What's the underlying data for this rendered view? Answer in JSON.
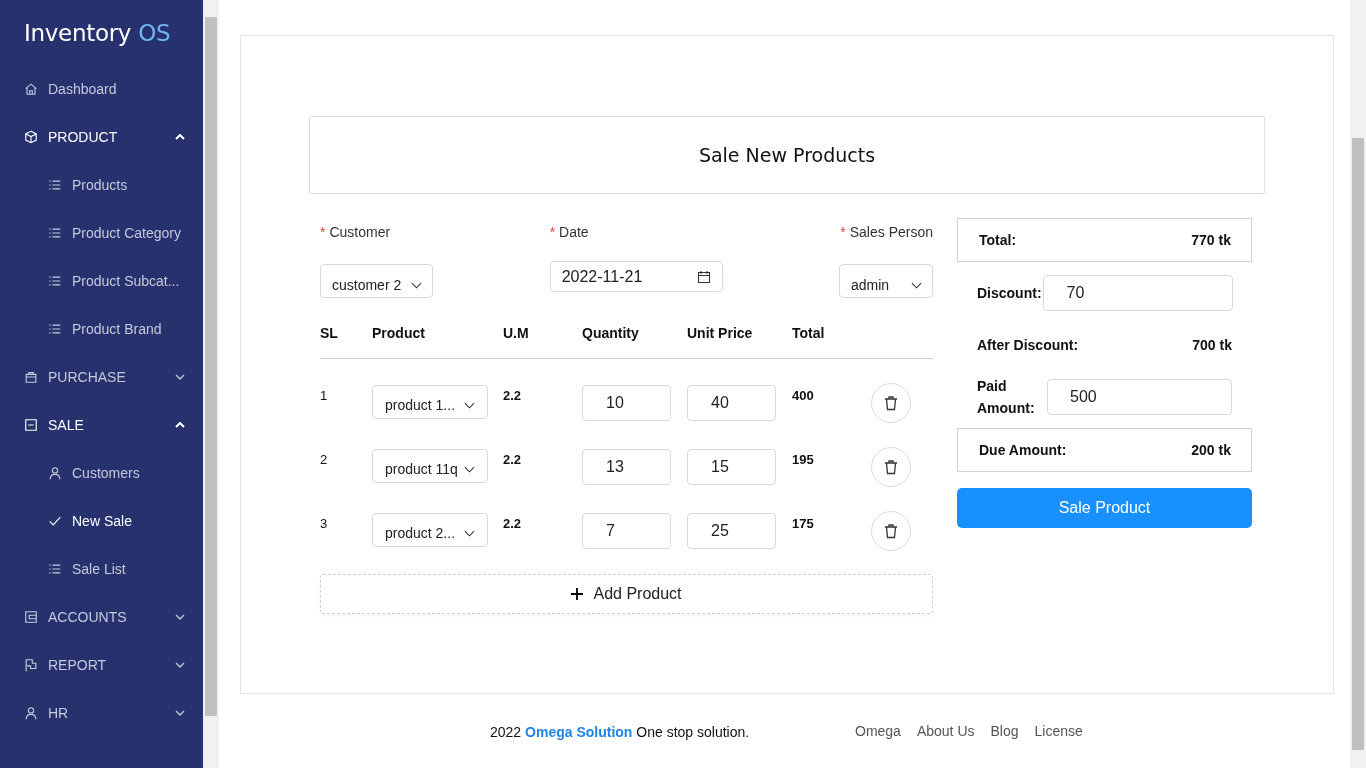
{
  "sidebar": {
    "logo": {
      "text": "Inventory",
      "accent": "OS"
    },
    "items": [
      {
        "label": "Dashboard",
        "kind": "home"
      },
      {
        "label": "PRODUCT",
        "kind": "box",
        "expanded": true,
        "children": [
          {
            "label": "Products",
            "kind": "list",
            "selected": false
          },
          {
            "label": "Product Category",
            "kind": "list",
            "selected": false
          },
          {
            "label": "Product Subcat...",
            "kind": "list",
            "selected": false
          },
          {
            "label": "Product Brand",
            "kind": "list",
            "selected": false
          }
        ]
      },
      {
        "label": "PURCHASE",
        "kind": "bag",
        "expanded": false
      },
      {
        "label": "SALE",
        "kind": "minus-square",
        "expanded": true,
        "children": [
          {
            "label": "Customers",
            "kind": "user",
            "selected": false
          },
          {
            "label": "New Sale",
            "kind": "check",
            "selected": true
          },
          {
            "label": "Sale List",
            "kind": "list",
            "selected": false
          }
        ]
      },
      {
        "label": "ACCOUNTS",
        "kind": "wallet",
        "expanded": false
      },
      {
        "label": "REPORT",
        "kind": "flag",
        "expanded": false
      },
      {
        "label": "HR",
        "kind": "user",
        "expanded": false
      }
    ]
  },
  "form": {
    "title": "Sale New Products",
    "fields": [
      {
        "label": "Customer",
        "required_mark": "*",
        "kind": "select",
        "value": "customer 2"
      },
      {
        "label": "Date",
        "required_mark": "*",
        "kind": "date",
        "value": "2022-11-21"
      },
      {
        "label": "Sales Person",
        "required_mark": "*",
        "kind": "select",
        "value": "admin"
      }
    ],
    "columns": [
      "SL",
      "Product",
      "U.M",
      "Quantity",
      "Unit Price",
      "Total"
    ],
    "rows": [
      {
        "sl": "1",
        "product": "product 1...",
        "um": "2.2",
        "quantity": "10",
        "unit_price": "40",
        "total": "400"
      },
      {
        "sl": "2",
        "product": "product 11q",
        "um": "2.2",
        "quantity": "13",
        "unit_price": "15",
        "total": "195"
      },
      {
        "sl": "3",
        "product": "product 2...",
        "um": "2.2",
        "quantity": "7",
        "unit_price": "25",
        "total": "175"
      }
    ],
    "add_button": "Add Product"
  },
  "summary": {
    "total_label": "Total:",
    "total_value": "770 tk",
    "discount_label": "Discount:",
    "discount_value": "70",
    "after_label": "After Discount:",
    "after_value": "700 tk",
    "paid_label": "Paid Amount:",
    "paid_value": "500",
    "due_label": "Due Amount:",
    "due_value": "200 tk",
    "button": "Sale Product"
  },
  "footer": {
    "year": "2022",
    "brand": "Omega Solution",
    "tagline": "One stop solution.",
    "links": [
      "Omega",
      "About Us",
      "Blog",
      "License"
    ]
  }
}
